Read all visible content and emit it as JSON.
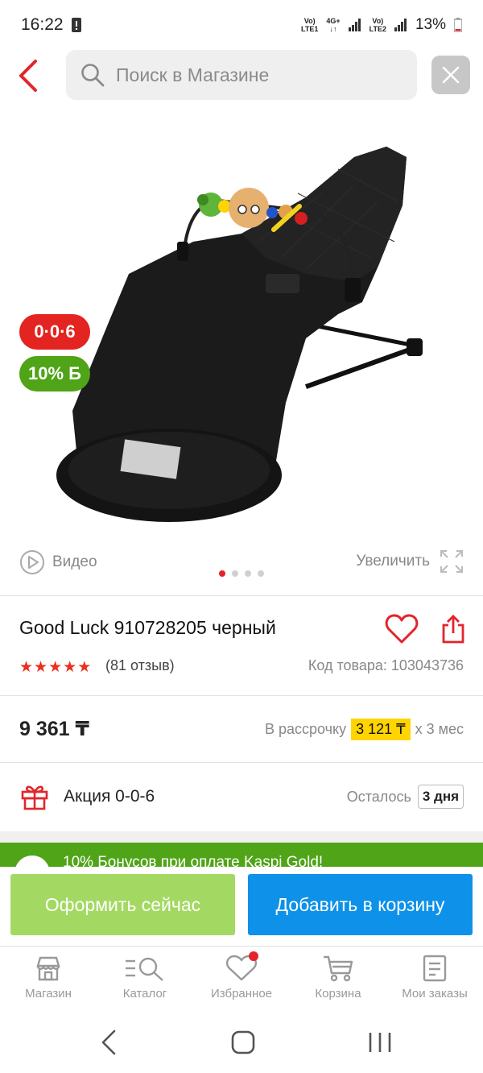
{
  "status_bar": {
    "time": "16:22",
    "net1_top": "Vo)",
    "net1_bottom": "LTE1",
    "net_mid": "4G+",
    "net2_top": "Vo)",
    "net2_bottom": "LTE2",
    "battery": "13%"
  },
  "search": {
    "placeholder": "Поиск в Магазине"
  },
  "badges": {
    "promo": "0·0·6",
    "bonus": "10%",
    "bonus_suffix": "Б"
  },
  "media": {
    "video_label": "Видео",
    "zoom_label": "Увеличить",
    "slide_count": 4,
    "active_slide": 1
  },
  "product": {
    "title": "Good Luck 910728205 черный",
    "rating": 5,
    "reviews": "(81 отзыв)",
    "sku": "Код товара: 103043736"
  },
  "price": {
    "value": "9 361 ₸",
    "installment_prefix": "В рассрочку",
    "installment_amount": "3 121 ₸",
    "installment_suffix": "x 3 мес"
  },
  "promo": {
    "name": "Акция 0-0-6",
    "remaining_label": "Осталось",
    "remaining_value": "3 дня"
  },
  "banner": {
    "text": "10% Бонусов при оплате Kaspi Gold!"
  },
  "actions": {
    "buy_now": "Оформить сейчас",
    "add_to_cart": "Добавить в корзину"
  },
  "tabs": [
    {
      "label": "Магазин",
      "icon": "store-icon"
    },
    {
      "label": "Каталог",
      "icon": "catalog-search-icon"
    },
    {
      "label": "Избранное",
      "icon": "heart-icon"
    },
    {
      "label": "Корзина",
      "icon": "cart-icon"
    },
    {
      "label": "Мои заказы",
      "icon": "orders-icon"
    }
  ],
  "colors": {
    "accent_red": "#e3242b",
    "green": "#4fa417",
    "blue": "#0e91e8",
    "light_green": "#a3d962",
    "yellow": "#ffd400"
  }
}
